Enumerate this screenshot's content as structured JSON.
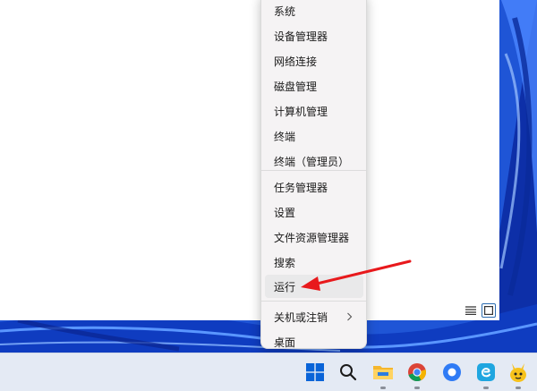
{
  "menu": {
    "items": [
      {
        "label": "系统"
      },
      {
        "label": "设备管理器"
      },
      {
        "label": "网络连接"
      },
      {
        "label": "磁盘管理"
      },
      {
        "label": "计算机管理"
      },
      {
        "label": "终端"
      },
      {
        "label": "终端（管理员）"
      },
      {
        "label": "任务管理器"
      },
      {
        "label": "设置"
      },
      {
        "label": "文件资源管理器"
      },
      {
        "label": "搜索"
      },
      {
        "label": "运行"
      },
      {
        "label": "关机或注销"
      },
      {
        "label": "桌面"
      }
    ],
    "highlighted": "运行",
    "submenu_item": "关机或注销"
  },
  "annotation": {
    "color": "#e8191c",
    "points_to": "运行"
  },
  "view_toggles": {
    "selected": "tiles-view-icon"
  },
  "taskbar": {
    "icons": [
      "windows-start-icon",
      "search-icon",
      "file-explorer-icon",
      "chrome-icon",
      "browser-app-icon",
      "edge-icon",
      "app-mascot-icon"
    ],
    "accent": "#0a64d8"
  },
  "colors": {
    "wallpaper": "#1f55d6",
    "menu_bg": "#f5f3f4",
    "taskbar_bg": "#e4eaf4"
  }
}
